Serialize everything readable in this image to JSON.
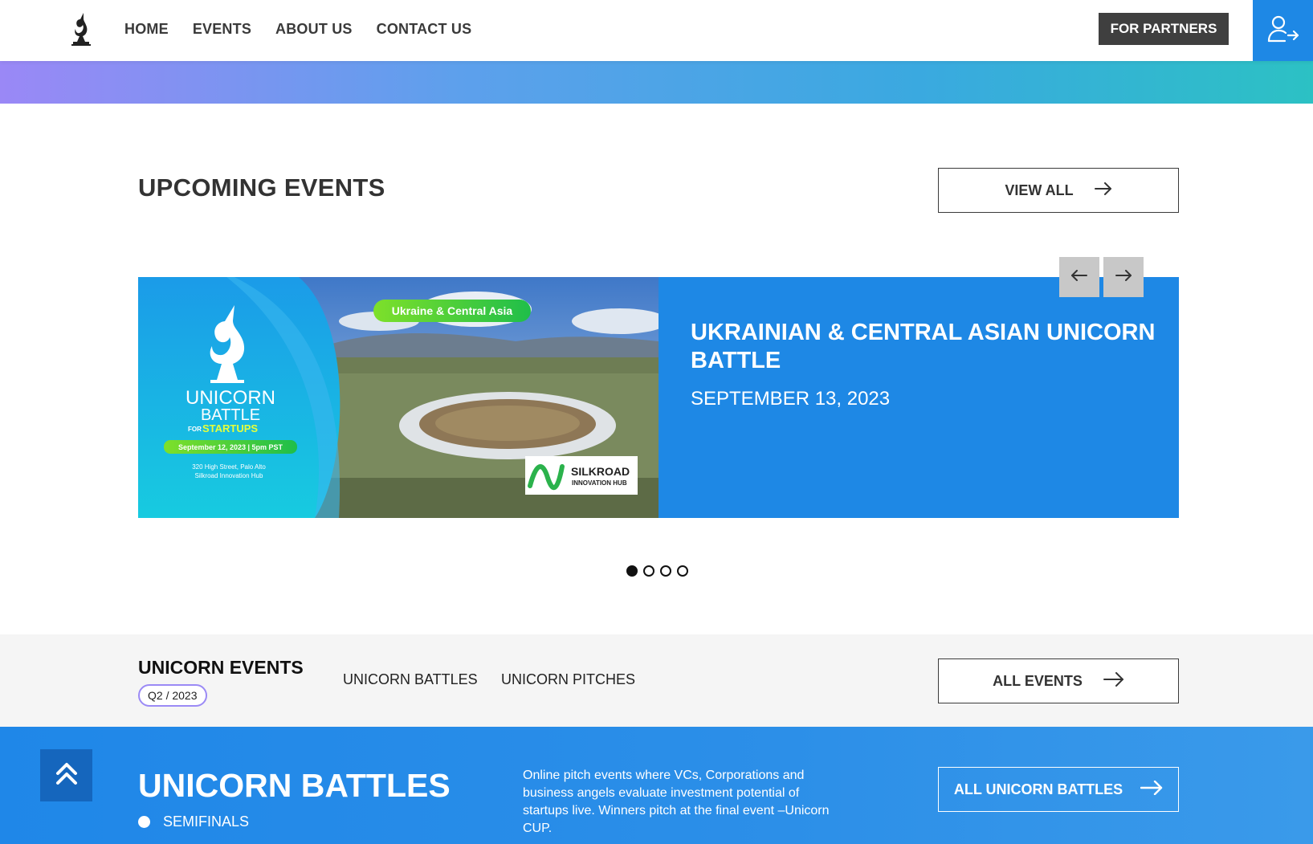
{
  "header": {
    "nav": [
      "HOME",
      "EVENTS",
      "ABOUT US",
      "CONTACT US"
    ],
    "partners_label": "FOR PARTNERS"
  },
  "upcoming": {
    "title": "UPCOMING EVENTS",
    "view_all_label": "VIEW ALL",
    "slide": {
      "title": "UKRAINIAN & CENTRAL ASIAN UNICORN BATTLE",
      "date": "SEPTEMBER 13, 2023",
      "image": {
        "region_tag": "Ukraine & Central Asia",
        "brand_line1": "UNICORN",
        "brand_line2": "BATTLE",
        "for_label": "FOR",
        "startups_label": "STARTUPS",
        "date_pill": "September 12, 2023  |  5pm PST",
        "address_line1": "320 High Street, Palo Alto",
        "address_line2": "Silkroad Innovation Hub",
        "partner_name": "SILKROAD",
        "partner_sub": "INNOVATION HUB"
      }
    },
    "dots": 4,
    "active_dot": 0
  },
  "events_bar": {
    "heading": "UNICORN EVENTS",
    "badge": "Q2 / 2023",
    "tabs": [
      "UNICORN BATTLES",
      "UNICORN PITCHES"
    ],
    "all_events_label": "ALL EVENTS"
  },
  "battles": {
    "title": "UNICORN BATTLES",
    "semifinals": "SEMIFINALS",
    "description": "Online pitch events where VCs, Corporations and business angels evaluate investment potential of startups live. Winners pitch at the final event –Unicorn CUP.",
    "all_label": "ALL UNICORN BATTLES"
  },
  "colors": {
    "accent": "#1e88e5",
    "dark_button": "#3f3f3f",
    "badge_border": "#9b8af5"
  }
}
